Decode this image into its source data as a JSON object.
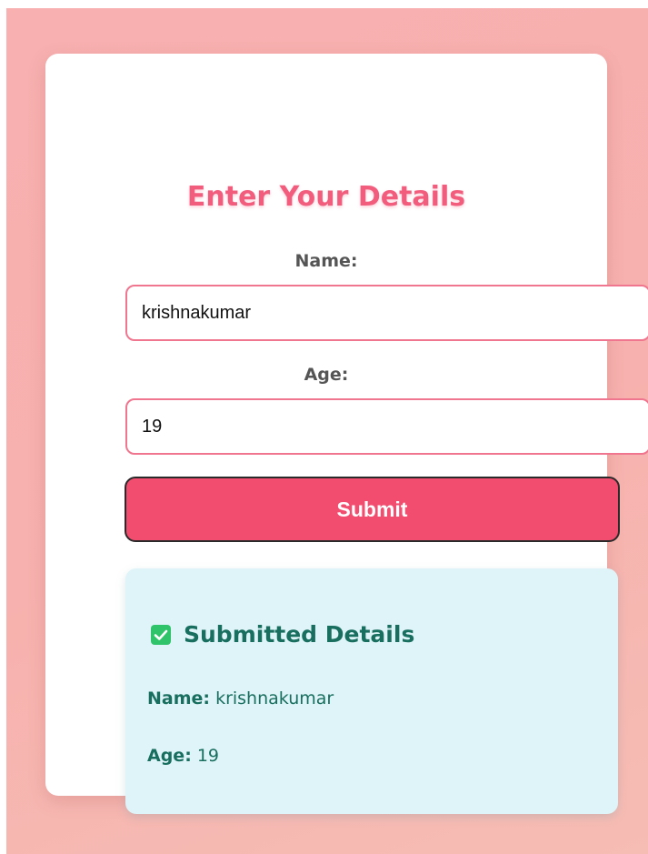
{
  "form": {
    "title": "Enter Your Details",
    "name_label": "Name:",
    "name_value": "krishnakumar",
    "age_label": "Age:",
    "age_value": "19",
    "submit_label": "Submit"
  },
  "result": {
    "icon": "check-box-icon",
    "title": "Submitted Details",
    "name_key": "Name:",
    "name_value": "krishnakumar",
    "age_key": "Age:",
    "age_value": "19"
  },
  "colors": {
    "accent": "#f24d6e",
    "title": "#f25d7d",
    "result_text": "#186e5f",
    "result_bg": "#dff4f8",
    "check": "#2fc46a"
  }
}
